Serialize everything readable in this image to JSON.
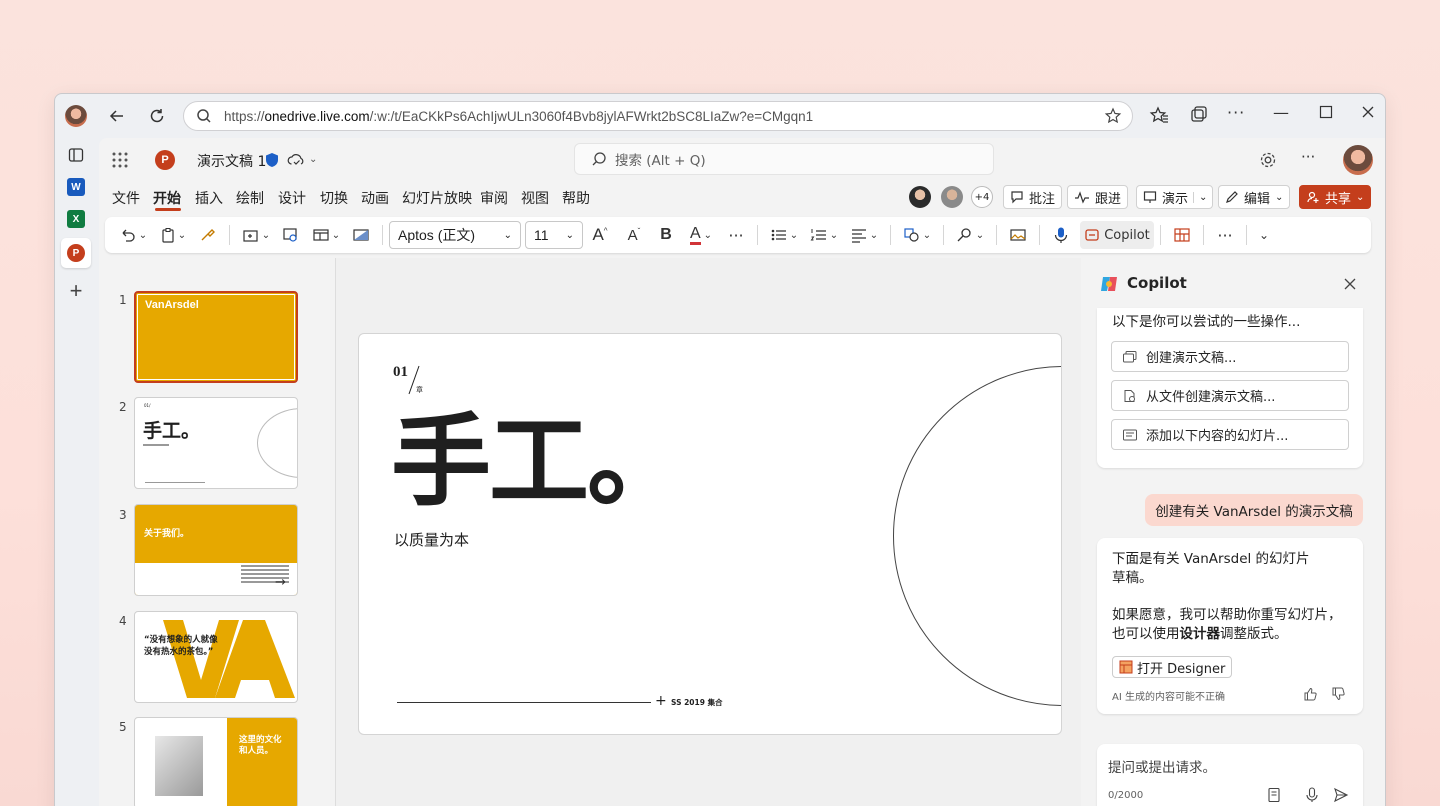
{
  "browser": {
    "url_prefix": "https://",
    "url_domain": "onedrive.live.com",
    "url_rest": "/:w:/t/EaCKkPs6AchIjwULn3060f4Bvb8jylAFWrkt2bSC8LIaZw?e=CMgqn1"
  },
  "app": {
    "doc_title": "演示文稿 1",
    "search_placeholder": "搜索 (Alt + Q)",
    "menu": [
      "文件",
      "开始",
      "插入",
      "绘制",
      "设计",
      "切换",
      "动画",
      "幻灯片放映",
      "审阅",
      "视图",
      "帮助"
    ],
    "active_menu": "开始",
    "collab_count": "+4",
    "buttons": {
      "comment": "批注",
      "track": "跟进",
      "present": "演示",
      "edit": "编辑",
      "share": "共享"
    }
  },
  "ribbon": {
    "font": "Aptos (正文)",
    "size": "11",
    "copilot": "Copilot"
  },
  "thumbnails": {
    "numbers": [
      "1",
      "2",
      "3",
      "4",
      "5"
    ],
    "t1_brand": "VanArsdel",
    "t2_title": "手工。",
    "t3_title": "关于我们。",
    "t4_quote_1": "“没有想象的人就像",
    "t4_quote_2": "没有热水的茶包。”",
    "t5_title_1": "这里的文化",
    "t5_title_2": "和人员。"
  },
  "slide": {
    "chapter_num": "01",
    "chapter_label": "章",
    "title": "手工。",
    "subtitle": "以质量为本",
    "footer": "SS 2019 集合"
  },
  "copilot": {
    "title": "Copilot",
    "intro": "以下是你可以尝试的一些操作...",
    "suggestions": [
      "创建演示文稿...",
      "从文件创建演示文稿...",
      "添加以下内容的幻灯片..."
    ],
    "user_msg": "创建有关 VanArsdel 的演示文稿",
    "reply_1a": "下面是有关 VanArsdel 的幻灯片",
    "reply_1b": "草稿。",
    "reply_2a": "如果愿意，我可以帮助你重写幻灯片，",
    "reply_2b_pre": "也可以使用",
    "reply_2b_bold": "设计器",
    "reply_2b_post": "调整版式。",
    "designer_btn": "打开 Designer",
    "disclaimer": "AI 生成的内容可能不正确",
    "input_placeholder": "提问或提出请求。",
    "counter": "0/2000"
  },
  "colors": {
    "accent": "#c43e1c",
    "gold": "#e6a800",
    "share": "#c43e1c"
  }
}
